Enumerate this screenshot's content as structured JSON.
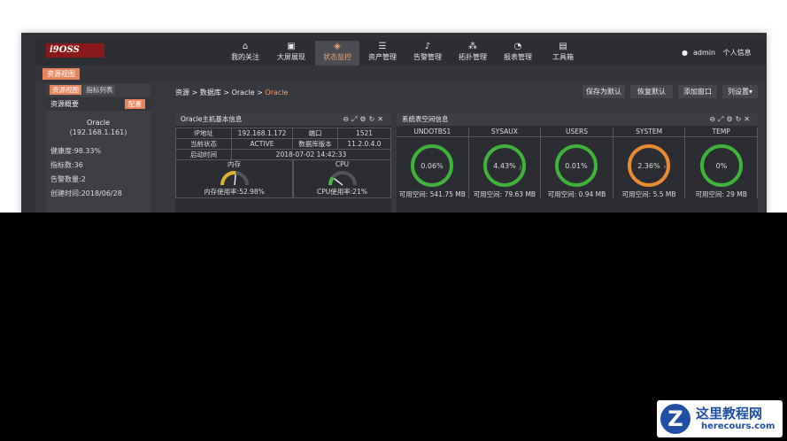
{
  "nav": {
    "items": [
      {
        "label": "我的关注",
        "icon": "home-icon"
      },
      {
        "label": "大屏展现",
        "icon": "screen-icon"
      },
      {
        "label": "状态监控",
        "icon": "layers-icon"
      },
      {
        "label": "资产管理",
        "icon": "list-icon"
      },
      {
        "label": "告警管理",
        "icon": "bell-icon"
      },
      {
        "label": "拓扑管理",
        "icon": "topology-icon"
      },
      {
        "label": "报表管理",
        "icon": "chart-icon"
      },
      {
        "label": "工具箱",
        "icon": "toolbox-icon"
      }
    ],
    "active_index": 2,
    "user": "admin",
    "profile": "个人信息",
    "accent": "#e8835b"
  },
  "tab_main": "资源视图",
  "left": {
    "tab_view": "资源视图",
    "tab_metrics": "指标列表",
    "overview": "资源概要",
    "config": "配置",
    "name": "Oracle",
    "ip": "(192.168.1.161)",
    "health": "健康度:98.33%",
    "metrics": "指标数:36",
    "alerts": "告警数量:2",
    "created": "创建时间:2018/06/28"
  },
  "crumb": {
    "path": "资源 > 数据库 > Oracle > ",
    "current": "Oracle"
  },
  "toolbar": {
    "save_default": "保存为默认",
    "restore_default": "恢复默认",
    "add_window": "添加窗口",
    "column_settings": "列设置▾"
  },
  "host_panel": {
    "title": "Oracle主机基本信息",
    "ip_label": "IP地址",
    "ip_value": "192.168.1.172",
    "port_label": "端口",
    "port_value": "1521",
    "status_label": "当前状态",
    "status_value": "ACTIVE",
    "version_label": "数据库版本",
    "version_value": "11.2.0.4.0",
    "start_label": "启动时间",
    "start_value": "2018-07-02 14:42:33",
    "mem_label": "内存",
    "cpu_label": "CPU",
    "mem_usage": "内存使用率:52.98%",
    "cpu_usage": "CPU使用率:21%",
    "mem_level": 0.5298,
    "cpu_level": 0.21
  },
  "ts_panel": {
    "title": "系统表空间信息",
    "columns": [
      {
        "name": "UNDOTBS1",
        "pct": "0.06%",
        "free": "可用空间: 541.75 MB",
        "color": "#3fb33a",
        "level": 0.0006
      },
      {
        "name": "SYSAUX",
        "pct": "4.43%",
        "free": "可用空间: 79.63 MB",
        "color": "#3fb33a",
        "level": 0.0443
      },
      {
        "name": "USERS",
        "pct": "0.01%",
        "free": "可用空间: 0.94 MB",
        "color": "#3fb33a",
        "level": 0.0001
      },
      {
        "name": "SYSTEM",
        "pct": "2.36%",
        "free": "可用空间: 5.5 MB",
        "color": "#e88a30",
        "level": 0.0236
      },
      {
        "name": "TEMP",
        "pct": "0%",
        "free": "可用空间: 29 MB",
        "color": "#3fb33a",
        "level": 0
      }
    ]
  },
  "watermark": {
    "badge": "Z",
    "line1": "这里教程网",
    "line2": "herecours.com"
  }
}
